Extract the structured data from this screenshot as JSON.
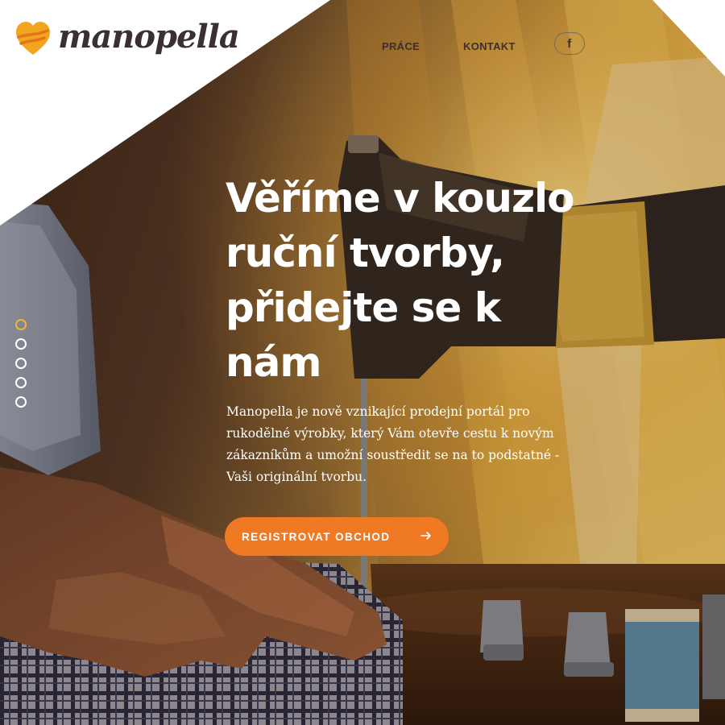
{
  "brand": {
    "name": "manopella",
    "accent": "#f07a23",
    "logo_heart_color": "#f2a51f"
  },
  "nav": {
    "items": [
      {
        "label": "PRÁCE"
      },
      {
        "label": "KONTAKT"
      }
    ],
    "social_icon": "facebook-icon",
    "social_glyph": "f"
  },
  "hero": {
    "title": "Věříme v kouzlo ruční tvorby, přidejte se k nám",
    "description": "Manopella je nově vznikající prodejní portál pro rukodělné výrobky, který Vám otevře cestu k novým zákazníkům a umožní soustředit se na to podstatné - Vaši originální tvorbu.",
    "cta_label": "REGISTROVAT OBCHOD",
    "cta_icon": "arrow-right-icon"
  },
  "slider": {
    "total": 5,
    "active": 1
  }
}
